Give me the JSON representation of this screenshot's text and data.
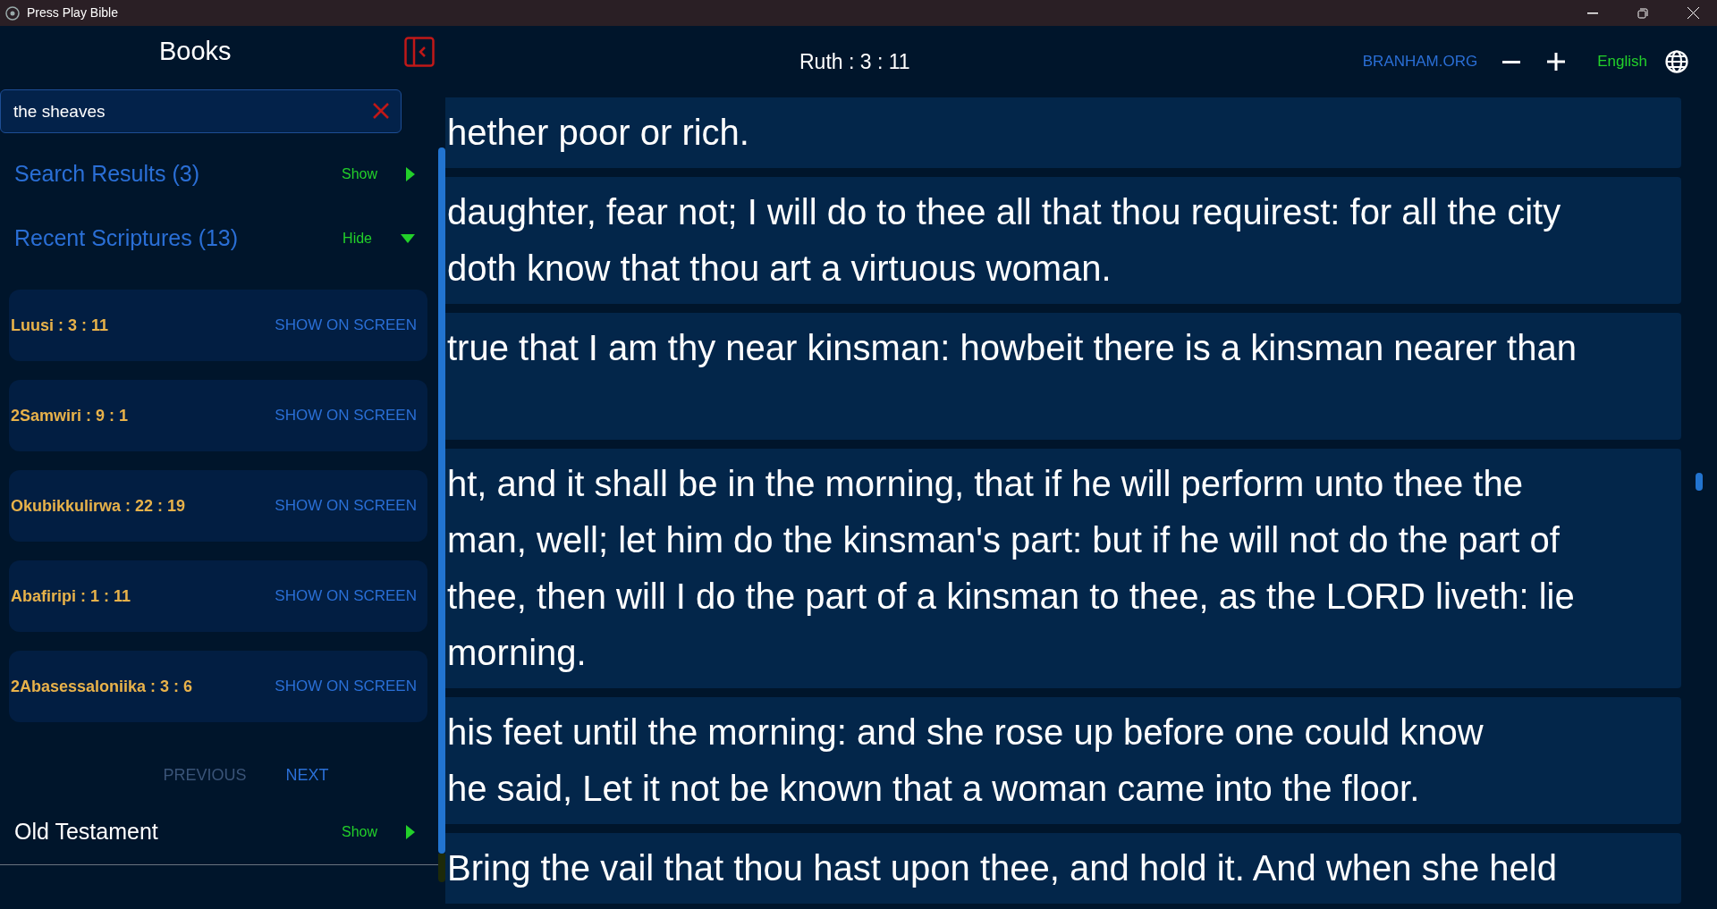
{
  "window": {
    "title": "Press Play Bible"
  },
  "sidebar": {
    "title": "Books",
    "search": {
      "value": "the sheaves"
    },
    "sections": [
      {
        "label": "Search Results (3)",
        "toggle": "Show",
        "expanded": false
      },
      {
        "label": "Recent Scriptures (13)",
        "toggle": "Hide",
        "expanded": true
      }
    ],
    "recent": [
      {
        "reference": "Luusi : 3 : 11",
        "action": "SHOW ON SCREEN"
      },
      {
        "reference": "2Samwiri : 9 : 1",
        "action": "SHOW ON SCREEN"
      },
      {
        "reference": "Okubikkulirwa : 22 : 19",
        "action": "SHOW ON SCREEN"
      },
      {
        "reference": "Abafiripi : 1 : 11",
        "action": "SHOW ON SCREEN"
      },
      {
        "reference": "2Abasessaloniika : 3 : 6",
        "action": "SHOW ON SCREEN"
      }
    ],
    "pager": [
      {
        "label": "PREVIOUS",
        "disabled": true
      },
      {
        "label": "NEXT",
        "disabled": false
      }
    ],
    "testament": {
      "label": "Old Testament",
      "toggle": "Show",
      "expanded": false
    }
  },
  "header": {
    "reference": "Ruth : 3 : 11",
    "link": "BRANHAM.ORG",
    "language": "English"
  },
  "verses": [
    {
      "lines": [
        "hether poor or rich."
      ]
    },
    {
      "lines": [
        "daughter, fear not; I will do to thee all that thou requirest: for all the city",
        "doth know that thou art a virtuous woman."
      ]
    },
    {
      "lines": [
        "true that I am thy near kinsman: howbeit there is a kinsman nearer than"
      ]
    },
    {
      "lines": [
        "ht, and it shall be in the morning, that if he will perform unto thee the",
        "man, well; let him do the kinsman's part: but if he will not do the part of",
        "thee, then will I do the part of a kinsman to thee, as the LORD liveth: lie",
        "morning."
      ]
    },
    {
      "lines": [
        "his feet until the morning: and she rose up before one could know",
        "he said, Let it not be known that a woman came into the floor."
      ]
    },
    {
      "lines": [
        "Bring the vail that thou hast upon thee, and hold it. And when she held"
      ]
    }
  ]
}
